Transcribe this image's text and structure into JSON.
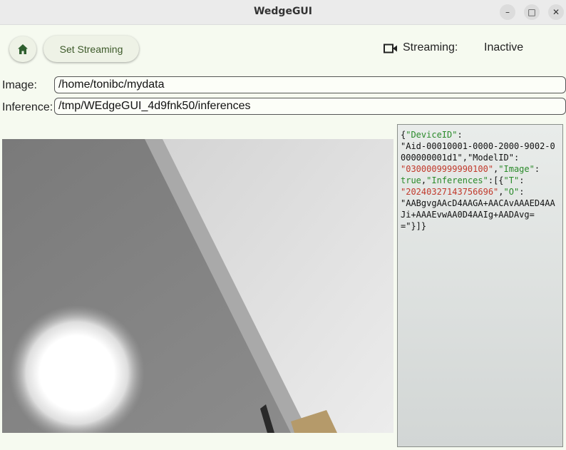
{
  "window": {
    "title": "WedgeGUI"
  },
  "toolbar": {
    "set_streaming_label": "Set Streaming"
  },
  "status": {
    "label": "Streaming:",
    "value": "Inactive"
  },
  "fields": {
    "image": {
      "label": "Image:",
      "value": "/home/tonibc/mydata"
    },
    "inference": {
      "label": "Inference:",
      "value": "/tmp/WEdgeGUI_4d9fnk50/inferences"
    }
  },
  "json_output": {
    "tokens": [
      {
        "t": "{",
        "c": "p"
      },
      {
        "t": "\"DeviceID\"",
        "c": "k"
      },
      {
        "t": ":\n",
        "c": "p"
      },
      {
        "t": "\"Aid-00010001-0000-2000-9002-0000000001d1\"",
        "c": "p"
      },
      {
        "t": ",",
        "c": "p"
      },
      {
        "t": "\"ModelID\"",
        "c": "p"
      },
      {
        "t": ":\n",
        "c": "p"
      },
      {
        "t": "\"0300009999990100\"",
        "c": "s"
      },
      {
        "t": ",",
        "c": "p"
      },
      {
        "t": "\"Image\"",
        "c": "k"
      },
      {
        "t": ":\n",
        "c": "p"
      },
      {
        "t": "true",
        "c": "b"
      },
      {
        "t": ",",
        "c": "p"
      },
      {
        "t": "\"Inferences\"",
        "c": "k"
      },
      {
        "t": ":[{",
        "c": "p"
      },
      {
        "t": "\"T\"",
        "c": "k"
      },
      {
        "t": ":\n",
        "c": "p"
      },
      {
        "t": "\"20240327143756696\"",
        "c": "s"
      },
      {
        "t": ",",
        "c": "p"
      },
      {
        "t": "\"O\"",
        "c": "k"
      },
      {
        "t": ":\n",
        "c": "p"
      },
      {
        "t": "\"AABgvgAAcD4AAGA+AACAvAAAED4AAJi+AAAEvwAA0D4AAIg+AADAvg==\"",
        "c": "p"
      },
      {
        "t": "}]}",
        "c": "p"
      }
    ]
  },
  "colors": {
    "background": "#f6faf0",
    "button_text": "#3d5a2a",
    "json_key": "#2a8a2a",
    "json_string": "#c0392b"
  },
  "icons": {
    "home": "home-icon",
    "camera": "video-camera-icon"
  }
}
